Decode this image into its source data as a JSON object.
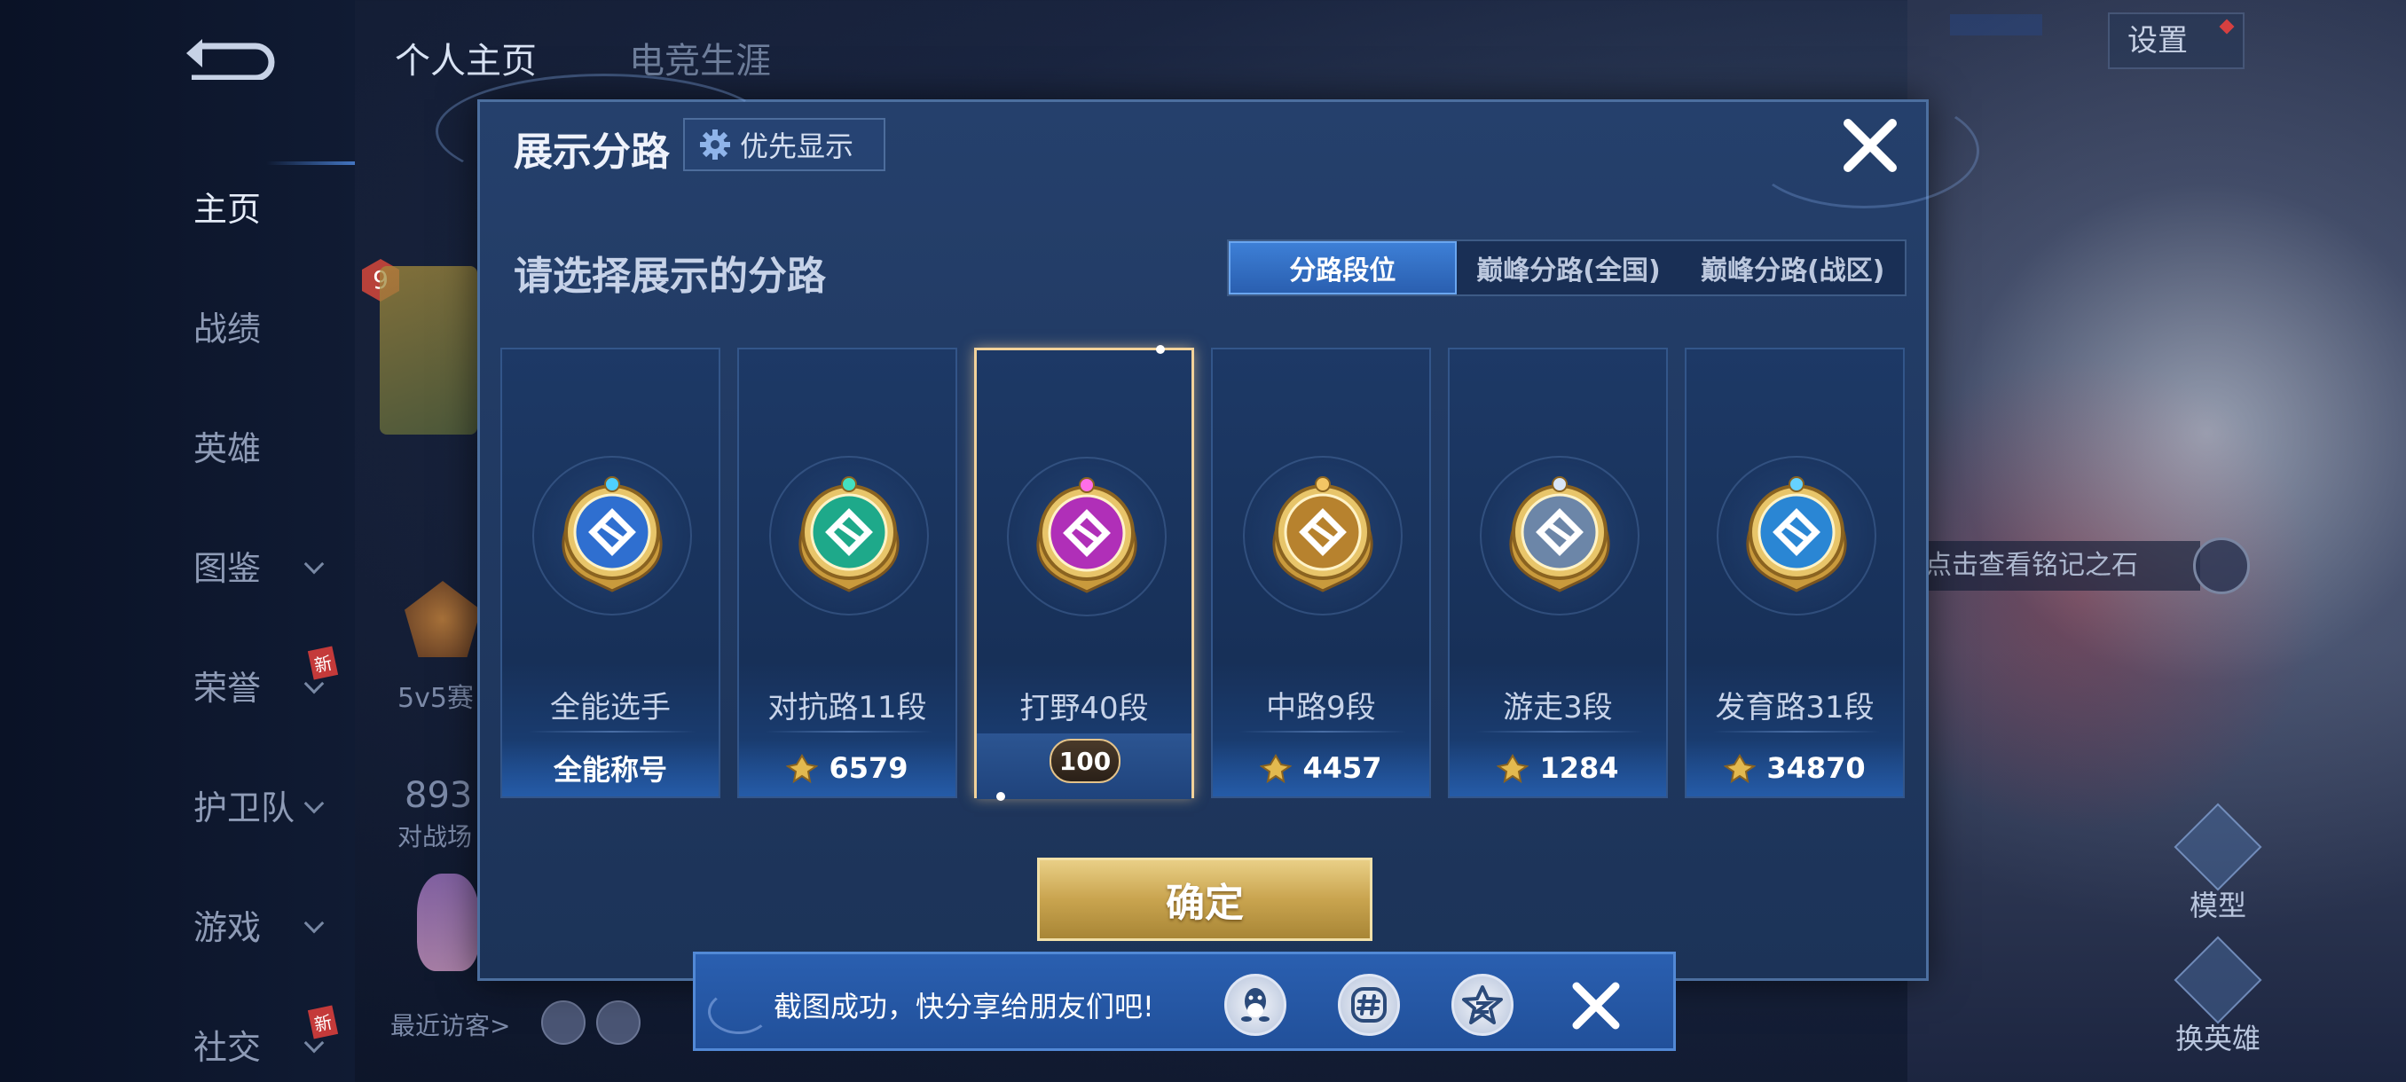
{
  "background": {
    "nav_tabs": [
      "个人主页",
      "电竞生涯"
    ],
    "sidebar": [
      {
        "label": "主页",
        "active": true,
        "chevron": false,
        "new": false
      },
      {
        "label": "战绩",
        "active": false,
        "chevron": false,
        "new": false
      },
      {
        "label": "英雄",
        "active": false,
        "chevron": false,
        "new": false
      },
      {
        "label": "图鉴",
        "active": false,
        "chevron": true,
        "new": false
      },
      {
        "label": "荣誉",
        "active": false,
        "chevron": true,
        "new": true
      },
      {
        "label": "护卫队",
        "active": false,
        "chevron": true,
        "new": false
      },
      {
        "label": "游戏",
        "active": false,
        "chevron": true,
        "new": false
      },
      {
        "label": "社交",
        "active": false,
        "chevron": true,
        "new": true
      }
    ],
    "new_tag": "新",
    "settings_label": "设置",
    "level_badge": "9",
    "fragments": {
      "mode_5v5": "5v5赛",
      "stat_number": "893",
      "stat_label": "对战场",
      "recent_visitors": "最近访客>"
    },
    "rune_hint": "点击查看铭记之石",
    "right_buttons": [
      "模型",
      "换英雄"
    ]
  },
  "modal": {
    "title": "展示分路",
    "priority_button": "优先显示",
    "prompt": "请选择展示的分路",
    "segments": [
      {
        "label": "分路段位",
        "active": true
      },
      {
        "label": "巅峰分路(全国)",
        "active": false
      },
      {
        "label": "巅峰分路(战区)",
        "active": false
      }
    ],
    "cards": [
      {
        "name": "全能选手",
        "value": "全能称号",
        "coin": false,
        "selected": false,
        "color": "#2f6fd0",
        "gem": "#4fd0ff"
      },
      {
        "name": "对抗路11段",
        "value": "6579",
        "coin": true,
        "selected": false,
        "color": "#1ea98a",
        "gem": "#43e0c0"
      },
      {
        "name": "打野40段",
        "value": "100",
        "coin": false,
        "selected": true,
        "color": "#b02fb8",
        "gem": "#ff6ee8"
      },
      {
        "name": "中路9段",
        "value": "4457",
        "coin": true,
        "selected": false,
        "color": "#b7822e",
        "gem": "#f3c664"
      },
      {
        "name": "游走3段",
        "value": "1284",
        "coin": true,
        "selected": false,
        "color": "#6c86a8",
        "gem": "#d9e6f6"
      },
      {
        "name": "发育路31段",
        "value": "34870",
        "coin": true,
        "selected": false,
        "color": "#2a86d4",
        "gem": "#66d2ff"
      }
    ],
    "confirm_label": "确定"
  },
  "toast": {
    "message": "截图成功，快分享给朋友们吧!",
    "share_targets": [
      "qq-icon",
      "hashtag-icon",
      "qzone-icon"
    ]
  },
  "colors": {
    "accent_blue": "#2a5fb0",
    "gold": "#c9a44f",
    "modal_bg": "#213a63"
  }
}
